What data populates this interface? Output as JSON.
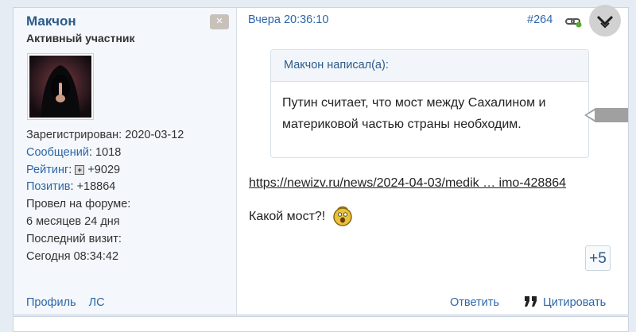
{
  "user": {
    "name": "Макчон",
    "title": "Активный участник",
    "registered": "Зарегистрирован: 2020-03-12",
    "messages_label": "Сообщений",
    "messages_value": ": 1018",
    "rating_label": "Рейтинг",
    "rating_value": "+9029",
    "positive_label": "Позитив",
    "positive_value": ": +18864",
    "forum_time_label": "Провел на форуме:",
    "forum_time_value": "6 месяцев 24 дня",
    "last_visit_label": "Последний визит:",
    "last_visit_value": "Сегодня 08:34:42",
    "profile_link": "Профиль",
    "pm_link": "ЛС"
  },
  "post": {
    "date": "Вчера 20:36:10",
    "number": "#264",
    "quote_author": "Макчон написал(а):",
    "quote_text": "Путин считает, что мост между Сахалином и материковой частью страны необходим.",
    "link": "https://newizv.ru/news/2024-04-03/medik … imo-428864",
    "text": "Какой мост?!",
    "likes": "+5",
    "reply_label": "Ответить",
    "quote_label": "Цитировать"
  },
  "icons": {
    "ignore": "close-icon",
    "link": "chain-link-icon",
    "circle": "expand-chevron-icon",
    "smiley": "shocked-smiley-icon",
    "quote": "quote-marks-icon",
    "rating": "plus-box-icon"
  },
  "colors": {
    "link": "#2c66a8",
    "username": "#2c5a8a",
    "page_bg": "#e6ecf3",
    "user_pane_bg": "#f4f7fb"
  }
}
